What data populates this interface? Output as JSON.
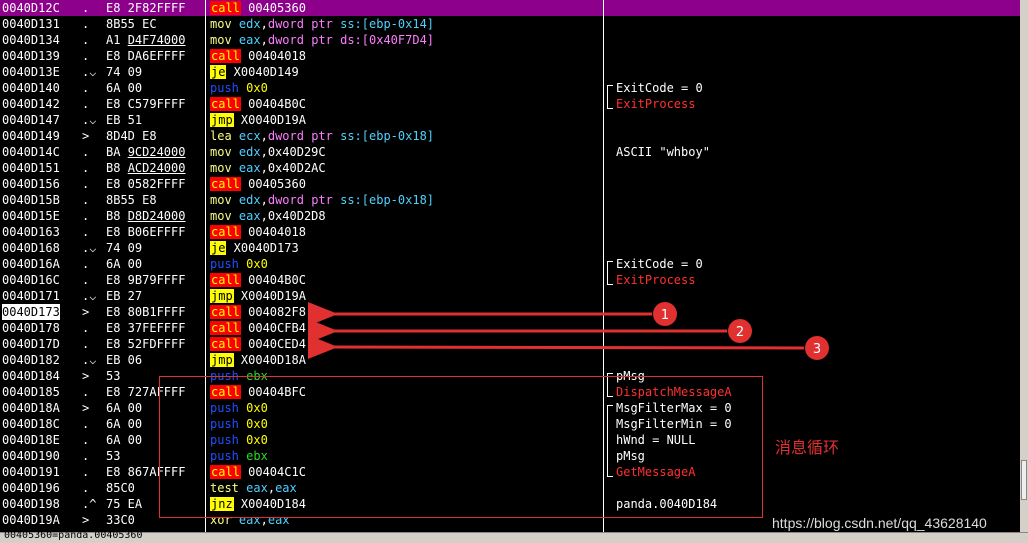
{
  "rows": [
    {
      "addr": "0040D12C",
      "mark": ".",
      "hex": "E8 2F82FFFF",
      "asm": [
        [
          "call",
          "m-call"
        ],
        [
          " 00405360",
          "t-white"
        ]
      ],
      "comment": "",
      "selected": true
    },
    {
      "addr": "0040D131",
      "mark": ".",
      "hex": "8B55 EC",
      "asm": [
        [
          "mov",
          "m-mov"
        ],
        [
          " ",
          "t-white"
        ],
        [
          "edx",
          "reg"
        ],
        [
          ",",
          "t-white"
        ],
        [
          "dword ptr",
          "mem"
        ],
        [
          " ss:[ebp-0x14]",
          "reg"
        ]
      ],
      "comment": ""
    },
    {
      "addr": "0040D134",
      "mark": ".",
      "hex": "A1 D4F74000",
      "hexUnderline": "D4F74000",
      "asm": [
        [
          "mov",
          "m-mov"
        ],
        [
          " ",
          "t-white"
        ],
        [
          "eax",
          "reg"
        ],
        [
          ",",
          "t-white"
        ],
        [
          "dword ptr",
          "mem"
        ],
        [
          " ds:[0x40F7D4]",
          "mem"
        ]
      ],
      "comment": ""
    },
    {
      "addr": "0040D139",
      "mark": ".",
      "hex": "E8 DA6EFFFF",
      "asm": [
        [
          "call",
          "m-call"
        ],
        [
          " 00404018",
          "t-white"
        ]
      ],
      "comment": ""
    },
    {
      "addr": "0040D13E",
      "mark": ".⌵",
      "hex": "74 09",
      "asm": [
        [
          "je",
          "m-jmp"
        ],
        [
          " X0040D149",
          "t-white"
        ]
      ],
      "comment": ""
    },
    {
      "addr": "0040D140",
      "mark": ".",
      "hex": "6A 00",
      "asm": [
        [
          "push",
          "m-push"
        ],
        [
          " 0x0",
          "num"
        ]
      ],
      "comment": "ExitCode = 0",
      "bracketTop": true
    },
    {
      "addr": "0040D142",
      "mark": ".",
      "hex": "E8 C579FFFF",
      "asm": [
        [
          "call",
          "m-call"
        ],
        [
          " 00404B0C",
          "t-white"
        ]
      ],
      "comment": "ExitProcess",
      "commentRed": true,
      "bracketEnd": true
    },
    {
      "addr": "0040D147",
      "mark": ".⌵",
      "hex": "EB 51",
      "asm": [
        [
          "jmp",
          "m-jmp"
        ],
        [
          " X0040D19A",
          "t-white"
        ]
      ],
      "comment": ""
    },
    {
      "addr": "0040D149",
      "mark": ">",
      "hex": "8D4D E8",
      "asm": [
        [
          "lea",
          "m-lea"
        ],
        [
          " ",
          "t-white"
        ],
        [
          "ecx",
          "reg"
        ],
        [
          ",",
          "t-white"
        ],
        [
          "dword ptr",
          "mem"
        ],
        [
          " ss:[ebp-0x18]",
          "reg"
        ]
      ],
      "comment": ""
    },
    {
      "addr": "0040D14C",
      "mark": ".",
      "hex": "BA 9CD24000",
      "hexUnderline": "9CD24000",
      "asm": [
        [
          "mov",
          "m-mov"
        ],
        [
          " ",
          "t-white"
        ],
        [
          "edx",
          "reg"
        ],
        [
          ",0x40D29C",
          "t-white"
        ]
      ],
      "comment": "ASCII \"whboy\""
    },
    {
      "addr": "0040D151",
      "mark": ".",
      "hex": "B8 ACD24000",
      "hexUnderline": "ACD24000",
      "asm": [
        [
          "mov",
          "m-mov"
        ],
        [
          " ",
          "t-white"
        ],
        [
          "eax",
          "reg"
        ],
        [
          ",0x40D2AC",
          "t-white"
        ]
      ],
      "comment": ""
    },
    {
      "addr": "0040D156",
      "mark": ".",
      "hex": "E8 0582FFFF",
      "asm": [
        [
          "call",
          "m-call"
        ],
        [
          " 00405360",
          "t-white"
        ]
      ],
      "comment": ""
    },
    {
      "addr": "0040D15B",
      "mark": ".",
      "hex": "8B55 E8",
      "asm": [
        [
          "mov",
          "m-mov"
        ],
        [
          " ",
          "t-white"
        ],
        [
          "edx",
          "reg"
        ],
        [
          ",",
          "t-white"
        ],
        [
          "dword ptr",
          "mem"
        ],
        [
          " ss:[ebp-0x18]",
          "reg"
        ]
      ],
      "comment": ""
    },
    {
      "addr": "0040D15E",
      "mark": ".",
      "hex": "B8 D8D24000",
      "hexUnderline": "D8D24000",
      "asm": [
        [
          "mov",
          "m-mov"
        ],
        [
          " ",
          "t-white"
        ],
        [
          "eax",
          "reg"
        ],
        [
          ",0x40D2D8",
          "t-white"
        ]
      ],
      "comment": ""
    },
    {
      "addr": "0040D163",
      "mark": ".",
      "hex": "E8 B06EFFFF",
      "asm": [
        [
          "call",
          "m-call"
        ],
        [
          " 00404018",
          "t-white"
        ]
      ],
      "comment": ""
    },
    {
      "addr": "0040D168",
      "mark": ".⌵",
      "hex": "74 09",
      "asm": [
        [
          "je",
          "m-jmp"
        ],
        [
          " X0040D173",
          "t-white"
        ]
      ],
      "comment": ""
    },
    {
      "addr": "0040D16A",
      "mark": ".",
      "hex": "6A 00",
      "asm": [
        [
          "push",
          "m-push"
        ],
        [
          " 0x0",
          "num"
        ]
      ],
      "comment": "ExitCode = 0",
      "bracketTop": true
    },
    {
      "addr": "0040D16C",
      "mark": ".",
      "hex": "E8 9B79FFFF",
      "asm": [
        [
          "call",
          "m-call"
        ],
        [
          " 00404B0C",
          "t-white"
        ]
      ],
      "comment": "ExitProcess",
      "commentRed": true,
      "bracketEnd": true
    },
    {
      "addr": "0040D171",
      "mark": ".⌵",
      "hex": "EB 27",
      "asm": [
        [
          "jmp",
          "m-jmp"
        ],
        [
          " X0040D19A",
          "t-white"
        ]
      ],
      "comment": ""
    },
    {
      "addr": "0040D173",
      "mark": ">",
      "hex": "E8 80B1FFFF",
      "asm": [
        [
          "call",
          "m-call"
        ],
        [
          " 004082F8",
          "t-white"
        ]
      ],
      "comment": "",
      "addrHighlight": true
    },
    {
      "addr": "0040D178",
      "mark": ".",
      "hex": "E8 37FEFFFF",
      "asm": [
        [
          "call",
          "m-call"
        ],
        [
          " 0040CFB4",
          "t-white"
        ]
      ],
      "comment": ""
    },
    {
      "addr": "0040D17D",
      "mark": ".",
      "hex": "E8 52FDFFFF",
      "asm": [
        [
          "call",
          "m-call"
        ],
        [
          " 0040CED4",
          "t-white"
        ]
      ],
      "comment": ""
    },
    {
      "addr": "0040D182",
      "mark": ".⌵",
      "hex": "EB 06",
      "asm": [
        [
          "jmp",
          "m-jmp"
        ],
        [
          " X0040D18A",
          "t-white"
        ]
      ],
      "comment": ""
    },
    {
      "addr": "0040D184",
      "mark": ">",
      "hex": "53",
      "asm": [
        [
          "push",
          "m-push"
        ],
        [
          " ebx",
          "t-green"
        ]
      ],
      "comment": "pMsg",
      "bracketTop": true
    },
    {
      "addr": "0040D185",
      "mark": ".",
      "hex": "E8 727AFFFF",
      "asm": [
        [
          "call",
          "m-call"
        ],
        [
          " 00404BFC",
          "t-white"
        ]
      ],
      "comment": "DispatchMessageA",
      "commentRed": true,
      "bracketEnd": true
    },
    {
      "addr": "0040D18A",
      "mark": ">",
      "hex": "6A 00",
      "asm": [
        [
          "push",
          "m-push"
        ],
        [
          " 0x0",
          "num"
        ]
      ],
      "comment": "MsgFilterMax = 0",
      "bracketTop": true
    },
    {
      "addr": "0040D18C",
      "mark": ".",
      "hex": "6A 00",
      "asm": [
        [
          "push",
          "m-push"
        ],
        [
          " 0x0",
          "num"
        ]
      ],
      "comment": "MsgFilterMin = 0"
    },
    {
      "addr": "0040D18E",
      "mark": ".",
      "hex": "6A 00",
      "asm": [
        [
          "push",
          "m-push"
        ],
        [
          " 0x0",
          "num"
        ]
      ],
      "comment": "hWnd = NULL"
    },
    {
      "addr": "0040D190",
      "mark": ".",
      "hex": "53",
      "asm": [
        [
          "push",
          "m-push"
        ],
        [
          " ebx",
          "t-green"
        ]
      ],
      "comment": "pMsg"
    },
    {
      "addr": "0040D191",
      "mark": ".",
      "hex": "E8 867AFFFF",
      "asm": [
        [
          "call",
          "m-call"
        ],
        [
          " 00404C1C",
          "t-white"
        ]
      ],
      "comment": "GetMessageA",
      "commentRed": true,
      "bracketEnd": true
    },
    {
      "addr": "0040D196",
      "mark": ".",
      "hex": "85C0",
      "asm": [
        [
          "test",
          "m-test"
        ],
        [
          " ",
          "t-white"
        ],
        [
          "eax",
          "reg"
        ],
        [
          ",",
          "t-white"
        ],
        [
          "eax",
          "reg"
        ]
      ],
      "comment": ""
    },
    {
      "addr": "0040D198",
      "mark": ".^",
      "hex": "75 EA",
      "asm": [
        [
          "jnz",
          "m-jmp"
        ],
        [
          " X0040D184",
          "t-white"
        ]
      ],
      "comment": "panda.0040D184"
    },
    {
      "addr": "0040D19A",
      "mark": ">",
      "hex": "33C0",
      "asm": [
        [
          "xor",
          "m-xor"
        ],
        [
          " ",
          "t-white"
        ],
        [
          "eax",
          "reg"
        ],
        [
          ",",
          "t-white"
        ],
        [
          "eax",
          "reg"
        ]
      ],
      "comment": ""
    }
  ],
  "annotations": {
    "markers": [
      "1",
      "2",
      "3"
    ],
    "region_label": "消息循环",
    "arrow_color": "#e03030"
  },
  "watermark": "https://blog.csdn.net/qq_43628140",
  "status": "00405360=panda.00405360"
}
